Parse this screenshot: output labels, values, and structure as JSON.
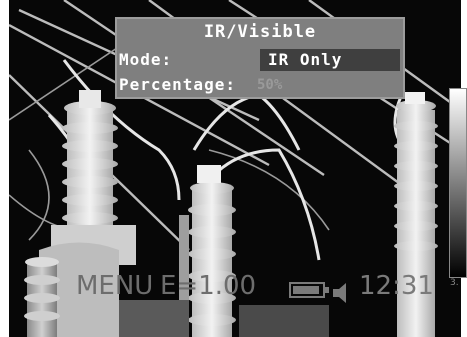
{
  "menu": {
    "title": "IR/Visible",
    "mode_label": "Mode:",
    "mode_value": "IR Only",
    "percentage_label": "Percentage:",
    "percentage_value": "50%"
  },
  "status": {
    "menu_label": "MENU",
    "emissivity": "E=1.00",
    "time": "12:31",
    "battery_icon": "battery-icon",
    "speaker_icon": "speaker-icon"
  },
  "palette": {
    "bottom_tick": "3."
  },
  "colors": {
    "menu_bg": "#7f7f7f",
    "highlight": "#3f3f3f",
    "screen_bg": "#070707"
  }
}
